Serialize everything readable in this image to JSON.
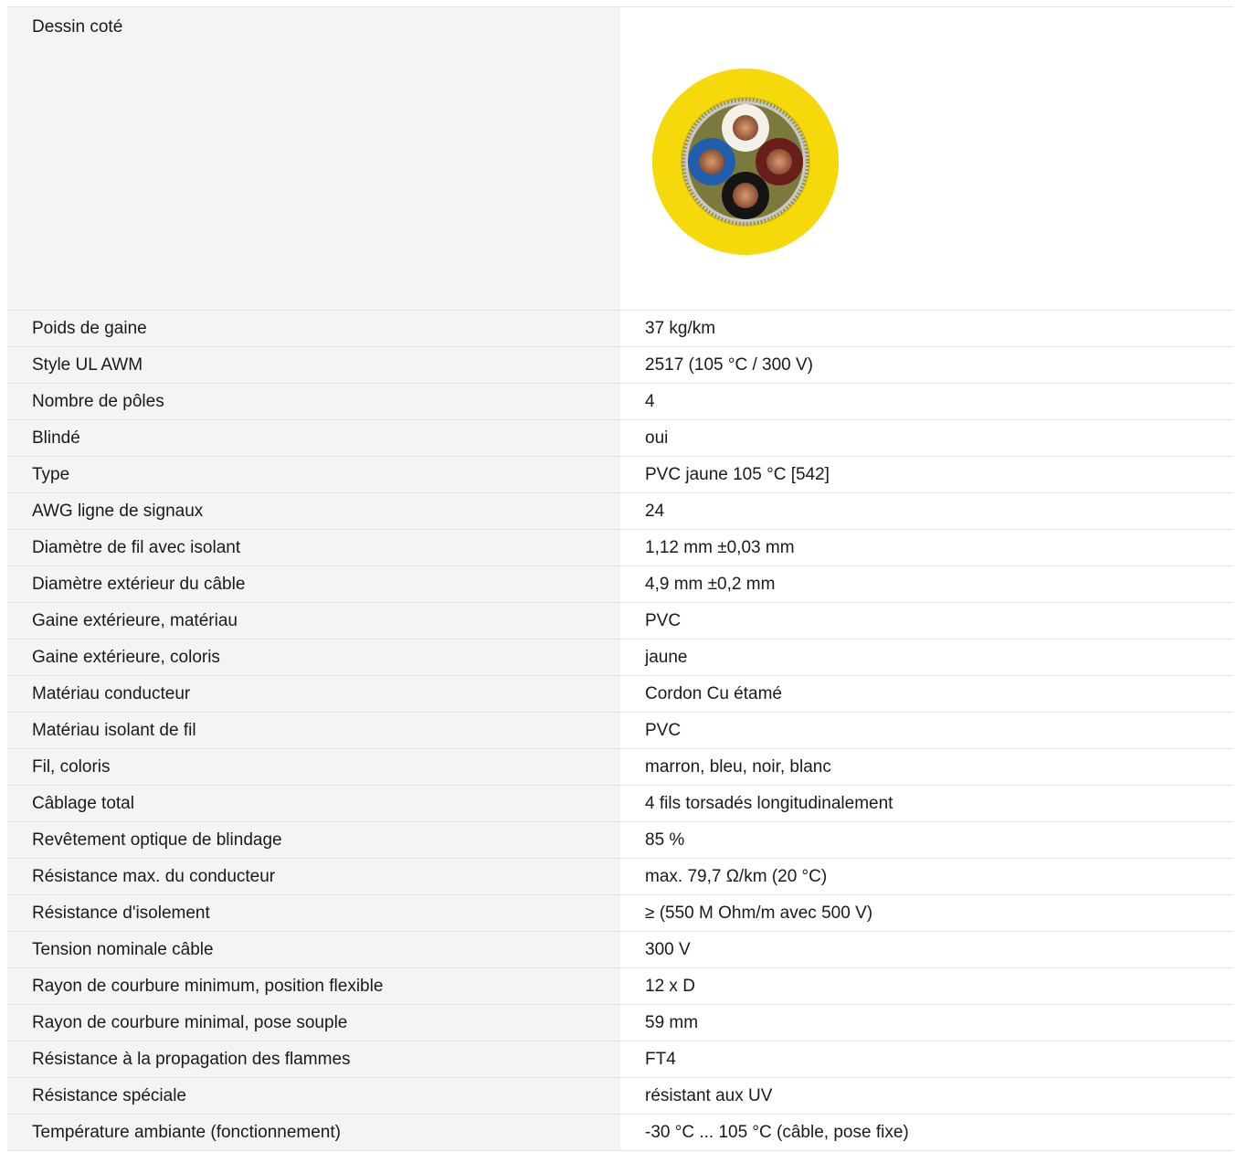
{
  "drawing": {
    "label": "Dessin coté",
    "image_icon": "cable-cross-section",
    "colors": {
      "jacket": "#f5d90a",
      "shield_filler": "#7b7a3c",
      "wire_white": "#f4f1ea",
      "wire_brown": "#6a1e1c",
      "wire_blue": "#1f5fae",
      "wire_black": "#141414",
      "copper": "#b87650"
    }
  },
  "specs": [
    {
      "label": "Poids de gaine",
      "value": "37 kg/km"
    },
    {
      "label": "Style UL AWM",
      "value": "2517 (105 °C / 300 V)"
    },
    {
      "label": "Nombre de pôles",
      "value": "4"
    },
    {
      "label": "Blindé",
      "value": "oui"
    },
    {
      "label": "Type",
      "value": "PVC jaune 105 °C [542]"
    },
    {
      "label": "AWG ligne de signaux",
      "value": "24"
    },
    {
      "label": "Diamètre de fil avec isolant",
      "value": "1,12 mm ±0,03 mm"
    },
    {
      "label": "Diamètre extérieur du câble",
      "value": "4,9 mm ±0,2 mm"
    },
    {
      "label": "Gaine extérieure, matériau",
      "value": "PVC"
    },
    {
      "label": "Gaine extérieure, coloris",
      "value": "jaune"
    },
    {
      "label": "Matériau conducteur",
      "value": "Cordon Cu étamé"
    },
    {
      "label": "Matériau isolant de fil",
      "value": "PVC"
    },
    {
      "label": "Fil, coloris",
      "value": "marron, bleu, noir, blanc"
    },
    {
      "label": "Câblage total",
      "value": "4 fils torsadés longitudinalement"
    },
    {
      "label": "Revêtement optique de blindage",
      "value": "85 %"
    },
    {
      "label": "Résistance max. du conducteur",
      "value": "max. 79,7 Ω/km (20 °C)"
    },
    {
      "label": "Résistance d'isolement",
      "value": "≥ (550 M Ohm/m avec 500 V)"
    },
    {
      "label": "Tension nominale câble",
      "value": "300 V"
    },
    {
      "label": "Rayon de courbure minimum, position flexible",
      "value": "12 x D"
    },
    {
      "label": "Rayon de courbure minimal, pose souple",
      "value": "59 mm"
    },
    {
      "label": "Résistance à la propagation des flammes",
      "value": "FT4"
    },
    {
      "label": "Résistance spéciale",
      "value": "résistant aux UV"
    },
    {
      "label": "Température ambiante (fonctionnement)",
      "value": "-30 °C ... 105 °C (câble, pose fixe)"
    }
  ]
}
